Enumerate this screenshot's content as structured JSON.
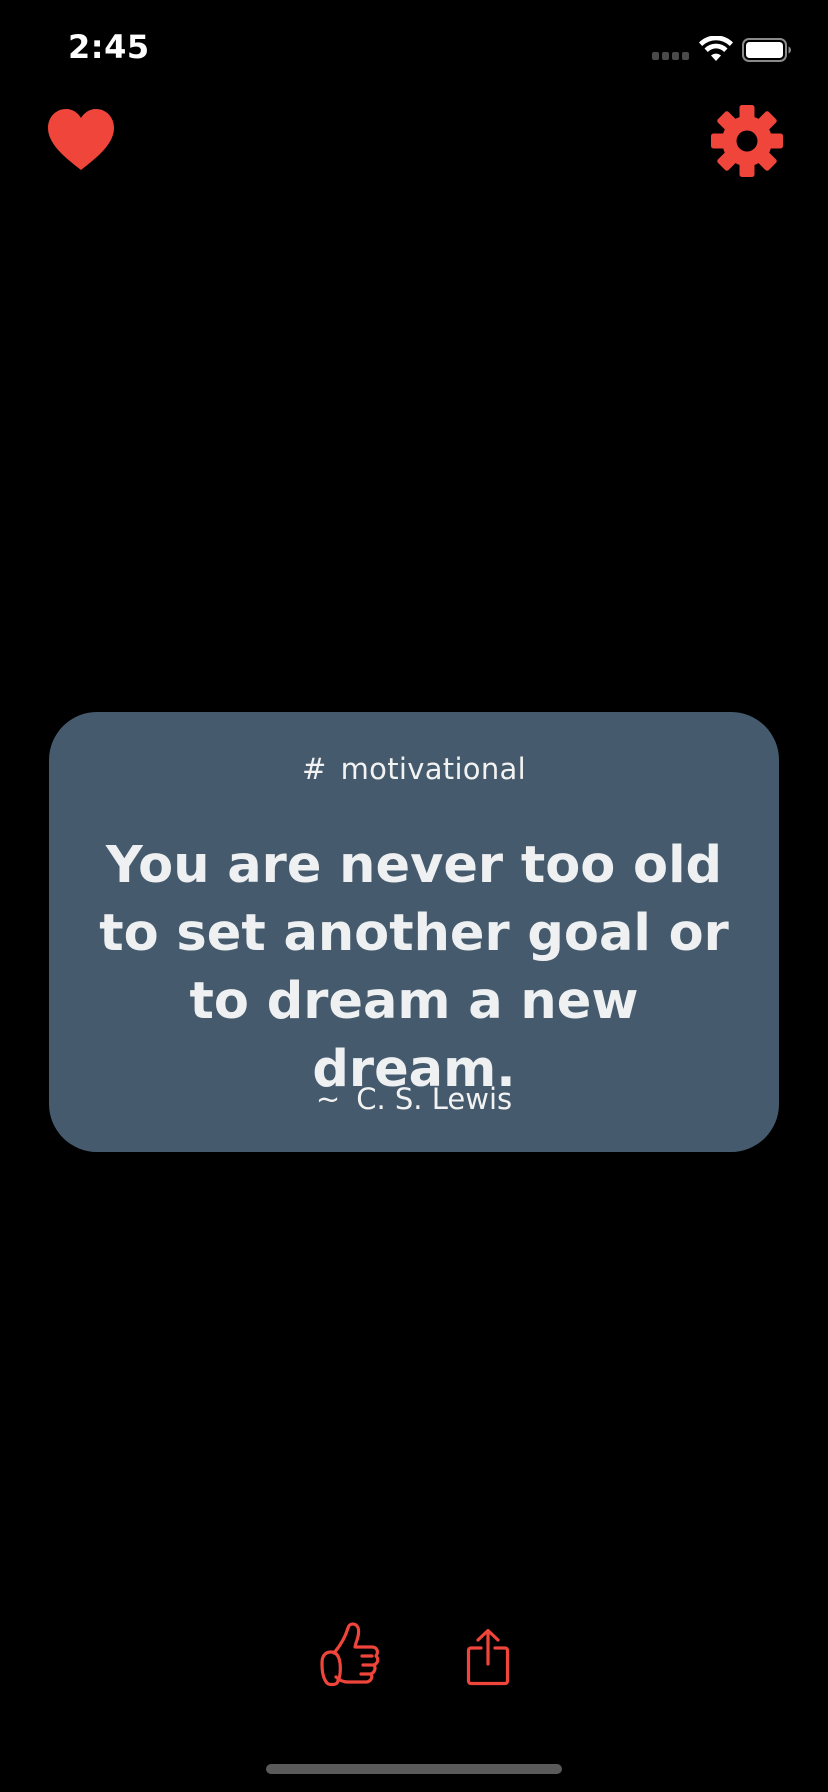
{
  "status_bar": {
    "time": "2:45"
  },
  "icons": {
    "favorites": "heart-icon",
    "settings": "gear-icon",
    "like": "thumbs-up-icon",
    "share": "share-icon"
  },
  "colors": {
    "accent": "#f0453a",
    "card_background": "#455b6d",
    "background": "#000000"
  },
  "quote": {
    "tag_prefix": "#",
    "tag": "motivational",
    "text": "You are never too old to set another goal or to dream a new dream.",
    "author_prefix": "~",
    "author": "C. S. Lewis"
  }
}
